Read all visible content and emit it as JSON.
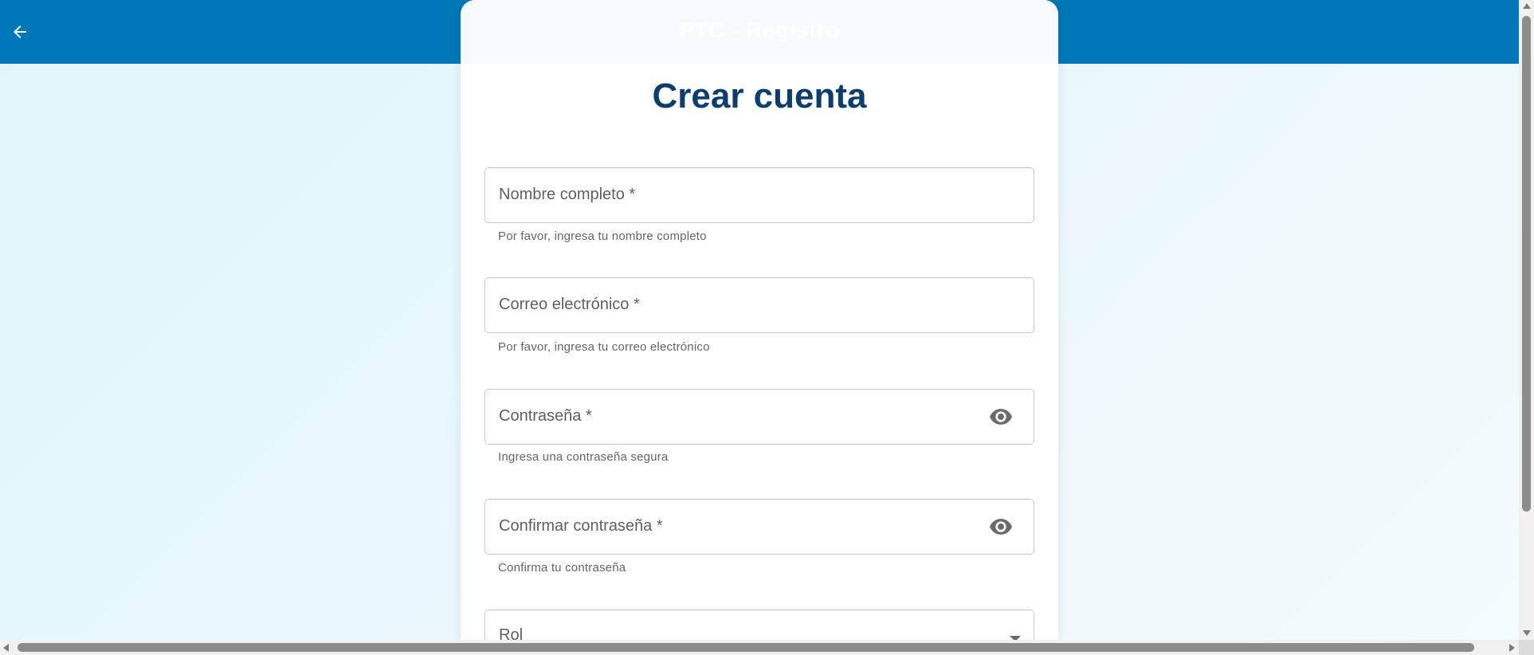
{
  "appbar": {
    "title": "PTC - Registro",
    "back_icon": "arrow-left-icon",
    "color": "#0077b6"
  },
  "form": {
    "heading": "Crear cuenta",
    "heading_color": "#0b3d6e",
    "fields": [
      {
        "label": "Nombre completo *",
        "helper": "Por favor, ingresa tu nombre completo",
        "value": ""
      },
      {
        "label": "Correo electrónico *",
        "helper": "Por favor, ingresa tu correo electrónico",
        "value": ""
      },
      {
        "label": "Contraseña *",
        "helper": "Ingresa una contraseña segura",
        "value": "",
        "icon": "eye-icon"
      },
      {
        "label": "Confirmar contraseña *",
        "helper": "Confirma tu contraseña",
        "value": "",
        "icon": "eye-icon"
      },
      {
        "label": "Rol",
        "value": "",
        "icon": "chevron-down-icon"
      }
    ]
  }
}
